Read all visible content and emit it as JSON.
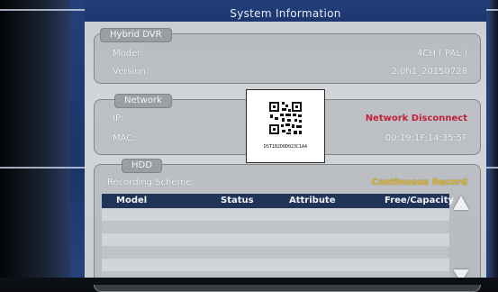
{
  "window": {
    "title": "System Information"
  },
  "dvr": {
    "group_title": "Hybrid DVR",
    "model_label": "Model:",
    "model_value": "4CH ( PAL )",
    "version_label": "Version:",
    "version_value": "2.0h1_20150728"
  },
  "network": {
    "group_title": "Network",
    "ip_label": "IP:",
    "ip_status": "Network Disconnect",
    "mac_label": "MAC:",
    "mac_value": "00:19:1F:14:35:5F"
  },
  "qr": {
    "serial": "DST1B2D0D023C1A4"
  },
  "hdd": {
    "group_title": "HDD",
    "recording_label": "Recording Scheme:",
    "recording_value": "Continuous Record",
    "columns": [
      "Model",
      "Status",
      "Attribute",
      "Free/Capacity"
    ],
    "row_count": 6
  },
  "colors": {
    "title_bar": "#1d3670",
    "disconnect": "#c2203a",
    "continuous": "#d8b53a",
    "table_header": "#1f3456"
  }
}
